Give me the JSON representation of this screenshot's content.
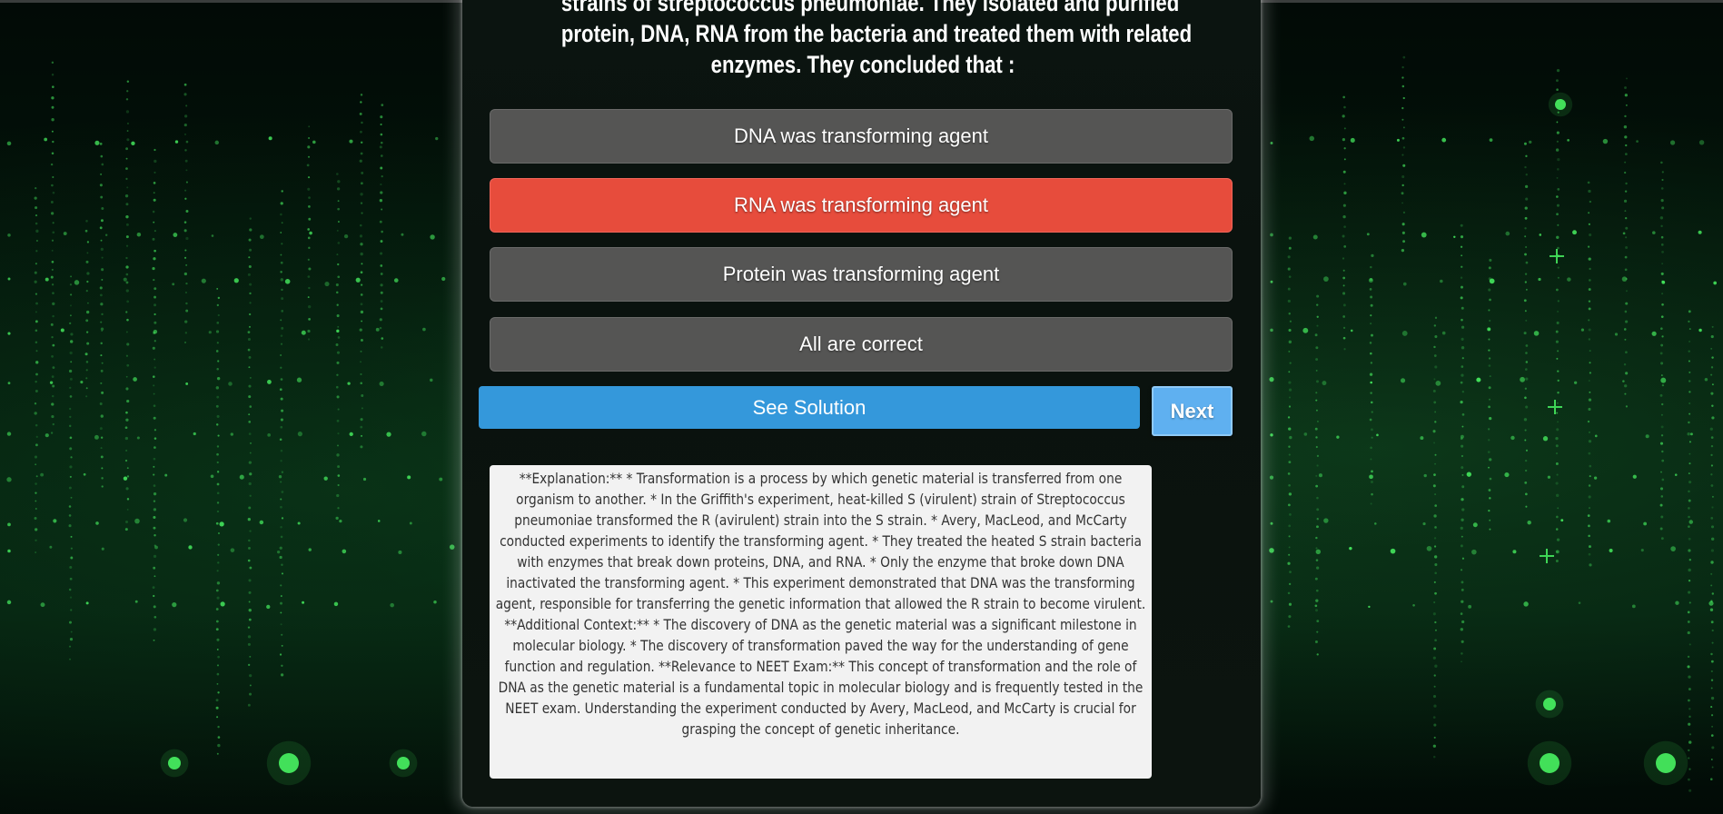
{
  "question": {
    "lines": [
      "strains of streptococcus pneumoniae. They isolated and purified",
      "protein, DNA, RNA from the bacteria and treated them with related",
      "enzymes. They concluded that :"
    ]
  },
  "options": [
    {
      "label": "DNA was transforming agent",
      "state": "default"
    },
    {
      "label": "RNA was transforming agent",
      "state": "wrong"
    },
    {
      "label": "Protein was transforming agent",
      "state": "default"
    },
    {
      "label": "All are correct",
      "state": "default"
    }
  ],
  "actions": {
    "see_solution_label": "See Solution",
    "next_label": "Next"
  },
  "explanation": {
    "text": "**Explanation:** * Transformation is a process by which genetic material is transferred from one organism to another. * In the Griffith's experiment, heat-killed S (virulent) strain of Streptococcus pneumoniae transformed the R (avirulent) strain into the S strain. * Avery, MacLeod, and McCarty conducted experiments to identify the transforming agent. * They treated the heated S strain bacteria with enzymes that break down proteins, DNA, and RNA. * Only the enzyme that broke down DNA inactivated the transforming agent. * This experiment demonstrated that DNA was the transforming agent, responsible for transferring the genetic information that allowed the R strain to become virulent. **Additional Context:** * The discovery of DNA as the genetic material was a significant milestone in molecular biology. * The discovery of transformation paved the way for the understanding of gene function and regulation. **Relevance to NEET Exam:** This concept of transformation and the role of DNA as the genetic material is a fundamental topic in molecular biology and is frequently tested in the NEET exam. Understanding the experiment conducted by Avery, MacLeod, and McCarty is crucial for grasping the concept of genetic inheritance."
  },
  "colors": {
    "option_default": "#555554",
    "option_wrong": "#e74c3c",
    "solution_button": "#3498db",
    "next_button": "#5fb0f0",
    "explanation_bg": "#f2f2f2",
    "background_glow": "#4cff66"
  }
}
